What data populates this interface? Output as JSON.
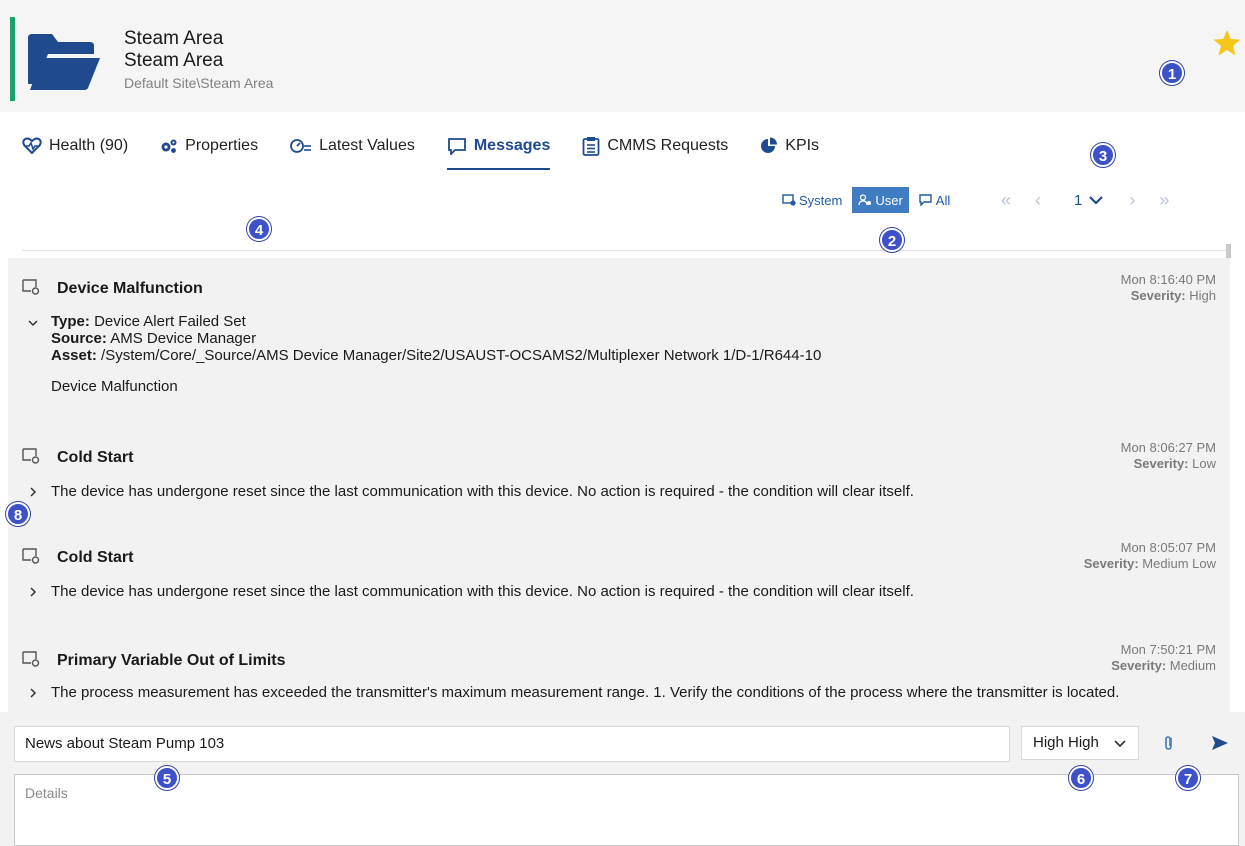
{
  "header": {
    "title_line_1": "Steam Area",
    "title_line_2": "Steam Area",
    "path": "Default Site\\Steam Area",
    "accent_color": "#1aa26c",
    "folder_color": "#1f4b8e",
    "star_color": "#f5c518"
  },
  "tabs": [
    {
      "label": "Health (90)",
      "icon": "heart-pulse-icon"
    },
    {
      "label": "Properties",
      "icon": "gears-icon"
    },
    {
      "label": "Latest Values",
      "icon": "gauge-list-icon"
    },
    {
      "label": "Messages",
      "icon": "message-icon",
      "active": true
    },
    {
      "label": "CMMS Requests",
      "icon": "clipboard-icon"
    },
    {
      "label": "KPIs",
      "icon": "pie-chart-icon"
    }
  ],
  "filters": {
    "system": "System",
    "user": "User",
    "all": "All",
    "active": "User"
  },
  "pager": {
    "first": "«",
    "prev": "‹",
    "page": "1",
    "next": "›",
    "last": "»"
  },
  "messages": [
    {
      "title": "Device Malfunction",
      "time": "Mon 8:16:40 PM",
      "severity_label": "Severity:",
      "severity": "High",
      "expanded": true,
      "type_label": "Type:",
      "type": "Device Alert Failed Set",
      "source_label": "Source:",
      "source": "AMS Device Manager",
      "asset_label": "Asset:",
      "asset": "/System/Core/_Source/AMS Device Manager/Site2/USAUST-OCSAMS2/Multiplexer Network 1/D-1/R644-10",
      "body": "Device Malfunction"
    },
    {
      "title": "Cold Start",
      "time": "Mon 8:06:27 PM",
      "severity_label": "Severity:",
      "severity": "Low",
      "body": "The device has undergone reset since the last communication with this device. No action is required - the condition will clear itself."
    },
    {
      "title": "Cold Start",
      "time": "Mon 8:05:07 PM",
      "severity_label": "Severity:",
      "severity": "Medium Low",
      "body": "The device has undergone reset since the last communication with this device. No action is required - the condition will clear itself."
    },
    {
      "title": "Primary Variable Out of Limits",
      "time": "Mon 7:50:21 PM",
      "severity_label": "Severity:",
      "severity": "Medium",
      "body": "The process measurement has exceeded the transmitter's maximum measurement range. 1. Verify the conditions of the process where the transmitter is located."
    }
  ],
  "compose": {
    "subject_value": "News about Steam Pump 103",
    "severity_value": "High High",
    "details_placeholder": "Details"
  },
  "callouts": [
    "1",
    "2",
    "3",
    "4",
    "5",
    "6",
    "7",
    "8"
  ],
  "callout_color": "#3d52c9"
}
